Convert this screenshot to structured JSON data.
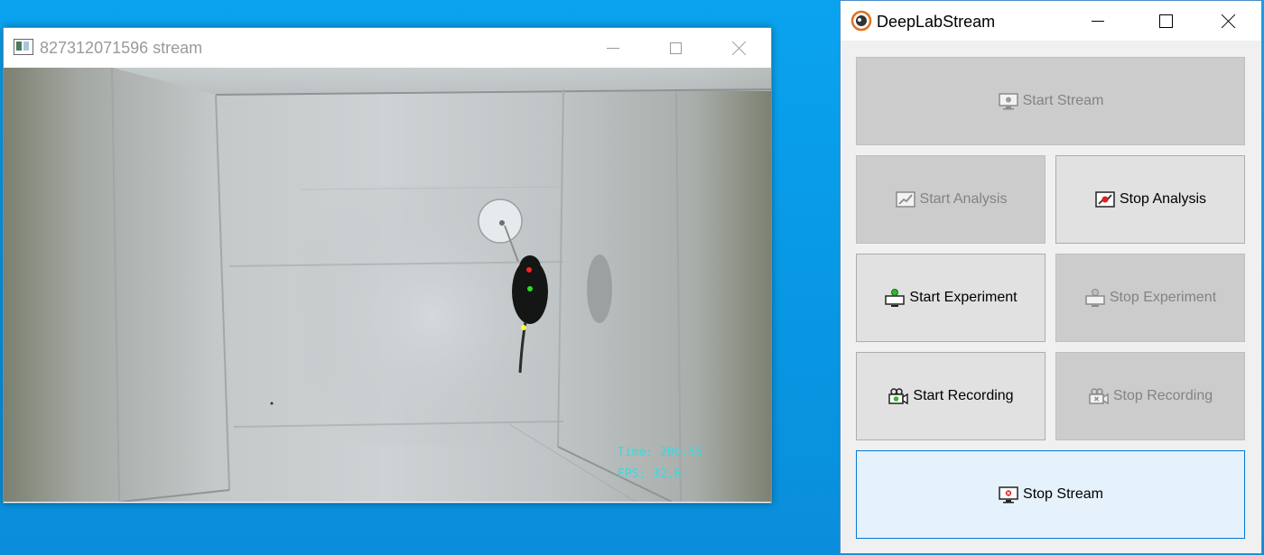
{
  "stream_window": {
    "title": "827312071596 stream",
    "overlay": {
      "time_text": "Time: 200.55",
      "fps_text": "FPS: 32.6"
    },
    "keypoint_colors": {
      "nose": "#ff2020",
      "center": "#28e028",
      "tailbase": "#ffff30"
    }
  },
  "dls_window": {
    "title": "DeepLabStream",
    "buttons": {
      "start_stream": {
        "label": "Start Stream",
        "state": "disabled",
        "icon": "monitor-camera-icon"
      },
      "start_analysis": {
        "label": "Start Analysis",
        "state": "disabled",
        "icon": "chart-up-icon"
      },
      "stop_analysis": {
        "label": "Stop Analysis",
        "state": "enabled",
        "icon": "chart-stop-icon"
      },
      "start_experiment": {
        "label": "Start Experiment",
        "state": "enabled",
        "icon": "experiment-start-icon"
      },
      "stop_experiment": {
        "label": "Stop Experiment",
        "state": "disabled",
        "icon": "experiment-stop-icon"
      },
      "start_recording": {
        "label": "Start Recording",
        "state": "enabled",
        "icon": "camcorder-start-icon"
      },
      "stop_recording": {
        "label": "Stop Recording",
        "state": "disabled",
        "icon": "camcorder-stop-icon"
      },
      "stop_stream": {
        "label": "Stop Stream",
        "state": "enabled-focused",
        "icon": "monitor-stop-icon"
      }
    }
  },
  "colors": {
    "desktop": "#0a9be8",
    "button_enabled": "#e1e1e1",
    "button_disabled": "#cccccc",
    "button_focused": "#e5f1fb",
    "focus_border": "#0078d7",
    "overlay_text": "#2fdde0"
  }
}
